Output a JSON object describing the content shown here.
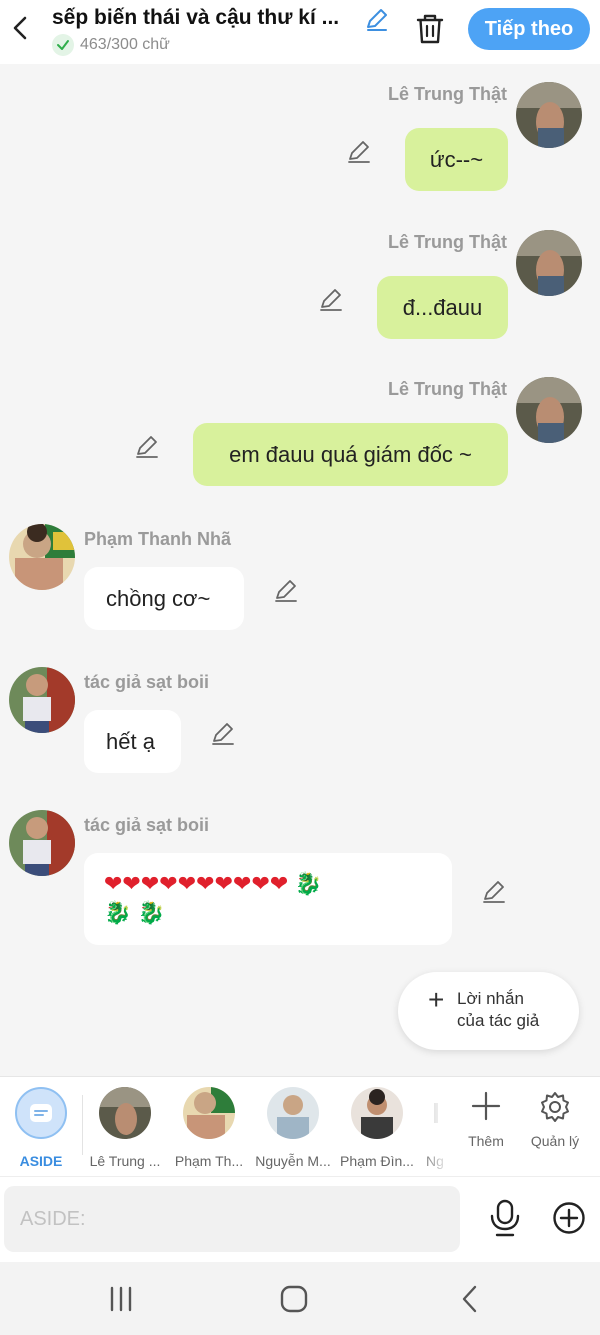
{
  "header": {
    "title": "sếp biến thái và cậu thư kí ...",
    "word_count": "463/300 chữ",
    "next_label": "Tiếp theo"
  },
  "messages": [
    {
      "sender": "Lê Trung Thật",
      "text": "ức--~",
      "side": "right"
    },
    {
      "sender": "Lê Trung Thật",
      "text": "đ...đauu",
      "side": "right"
    },
    {
      "sender": "Lê Trung Thật",
      "text": "em đauu quá giám đốc ~",
      "side": "right"
    },
    {
      "sender": "Phạm Thanh Nhã",
      "text": "chồng cơ~",
      "side": "left"
    },
    {
      "sender": "tác giả sạt boii",
      "text": "hết ạ",
      "side": "left"
    },
    {
      "sender": "tác giả sạt boii",
      "text_hearts": "❤❤❤❤❤❤❤❤❤❤",
      "text_dragons_line1": "🐉",
      "text_dragons_line2": "🐉 🐉",
      "side": "left"
    }
  ],
  "author_note": {
    "line1": "Lời nhắn",
    "line2": "của tác giả"
  },
  "characters": [
    {
      "label": "ASIDE"
    },
    {
      "label": "Lê Trung ..."
    },
    {
      "label": "Phạm Th..."
    },
    {
      "label": "Nguyễn M..."
    },
    {
      "label": "Phạm Đìn..."
    },
    {
      "label": "Ng"
    }
  ],
  "tools": {
    "add_label": "Thêm",
    "manage_label": "Quản lý"
  },
  "input": {
    "placeholder": "ASIDE:"
  },
  "colors": {
    "accent": "#4da3f5",
    "my_bubble": "#d8f19c",
    "other_bubble": "#ffffff",
    "background": "#f5f5f5"
  },
  "icons": [
    "back-arrow-icon",
    "pencil-icon",
    "check-icon",
    "trash-icon",
    "chat-bubble-icon",
    "plus-icon",
    "gear-icon",
    "microphone-icon",
    "plus-circle-icon",
    "recent-apps-icon",
    "home-icon",
    "nav-back-icon"
  ]
}
